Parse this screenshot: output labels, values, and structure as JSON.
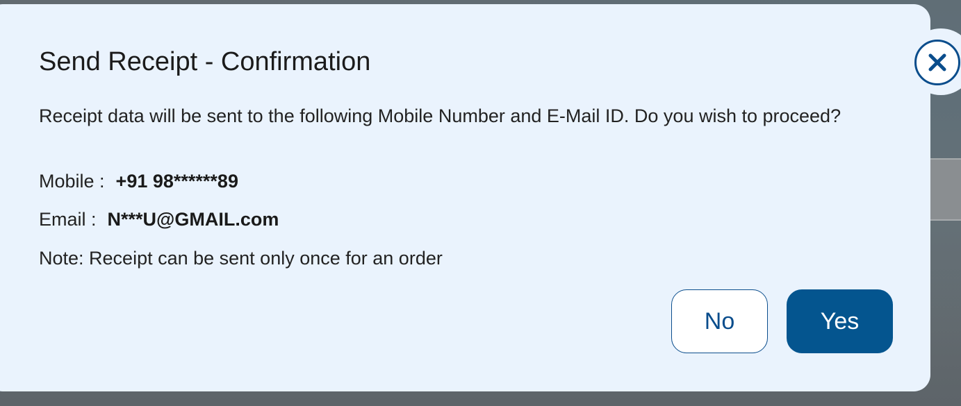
{
  "dialog": {
    "title": "Send Receipt - Confirmation",
    "message": "Receipt data will be sent to the following Mobile Number and E-Mail ID. Do you wish to proceed?",
    "mobile_label": "Mobile :",
    "mobile_value": "+91 98******89",
    "email_label": "Email :",
    "email_value": "N***U@GMAIL.com",
    "note": "Note: Receipt can be sent only once for an order",
    "no_label": "No",
    "yes_label": "Yes",
    "close_icon": "close-icon"
  },
  "colors": {
    "dialog_background": "#eaf3fd",
    "primary": "#04558f",
    "outline": "#0a4d8c",
    "text": "#222222"
  }
}
